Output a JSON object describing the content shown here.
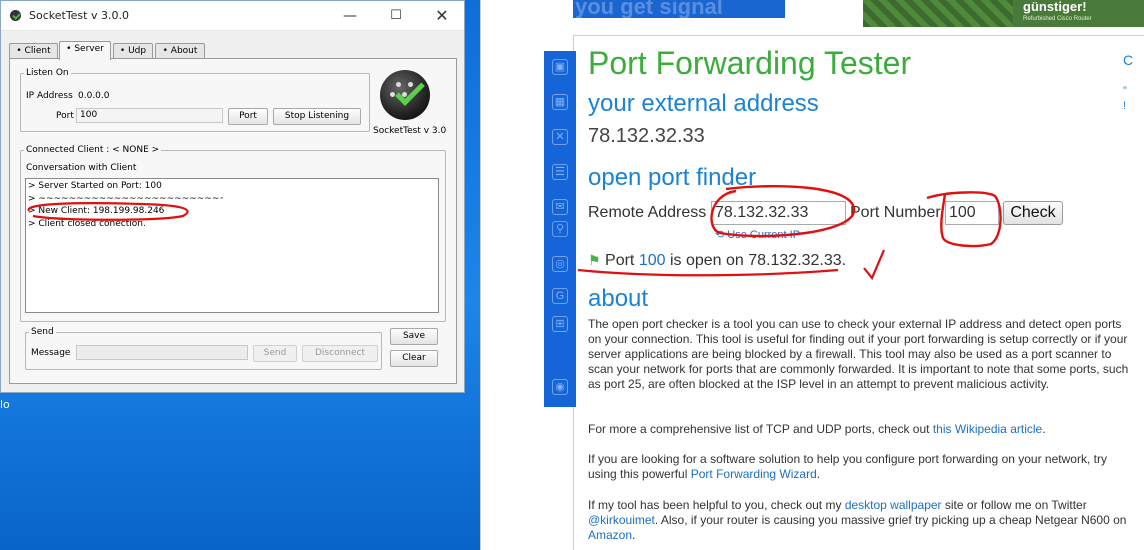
{
  "socketTest": {
    "title": "SocketTest v 3.0.0",
    "window_buttons": {
      "minimize": "—",
      "maximize": "☐",
      "close": "✕"
    },
    "tabs": [
      {
        "label": "Client"
      },
      {
        "label": "Server",
        "active": true
      },
      {
        "label": "Udp"
      },
      {
        "label": "About"
      }
    ],
    "listen": {
      "legend": "Listen On",
      "ip_label": "IP Address",
      "ip_value": "0.0.0.0",
      "port_label": "Port",
      "port_value": "100",
      "port_button": "Port",
      "stop_button": "Stop Listening"
    },
    "logo_caption": "SocketTest v 3.0",
    "connected": {
      "legend": "Connected Client : < NONE >",
      "conversation_label": "Conversation with Client",
      "log": [
        "> Server Started on Port: 100",
        "> ~~~~~~~~~~~~~~~~~~~~~~~~~~~~~~~~~",
        "> New Client: 198.199.98.246",
        "> Client closed conection."
      ]
    },
    "send": {
      "legend": "Send",
      "message_label": "Message",
      "message_value": "",
      "send_button": "Send",
      "disconnect_button": "Disconnect",
      "save_button": "Save",
      "clear_button": "Clear"
    }
  },
  "desktop_stub": "lo",
  "website": {
    "brand_fragment": "you get signal",
    "ad": {
      "headline": "günstiger!",
      "sub": "Refurbished Cisco Router"
    },
    "title": "Port Forwarding Tester",
    "external_heading": "your external address",
    "external_ip": "78.132.32.33",
    "finder_heading": "open port finder",
    "remote_label": "Remote Address",
    "remote_value": "78.132.32.33",
    "port_label": "Port Number",
    "port_value": "100",
    "check_button": "Check",
    "use_current": "Use Current IP",
    "result": {
      "prefix": "Port ",
      "port": "100",
      "middle": " is open on ",
      "ip": "78.132.32.33",
      "suffix": "."
    },
    "about_heading": "about",
    "about_p1": "The open port checker is a tool you can use to check your external IP address and detect open ports on your connection. This tool is useful for finding out if your port forwarding is setup correctly or if your server applications are being blocked by a firewall. This tool may also be used as a port scanner to scan your network for ports that are commonly forwarded. It is important to note that some ports, such as port 25, are often blocked at the ISP level in an attempt to prevent malicious activity.",
    "about_p2": {
      "text": "For more a comprehensive list of TCP and UDP ports, check out ",
      "link": "this Wikipedia article",
      "end": "."
    },
    "about_p3": {
      "text": "If you are looking for a software solution to help you configure port forwarding on your network, try using this powerful ",
      "link": "Port Forwarding Wizard",
      "end": "."
    },
    "about_p4": {
      "t1": "If my tool has been helpful to you, check out my ",
      "l1": "desktop wallpaper",
      "t2": " site or follow me on Twitter ",
      "l2": "@kirkouimet",
      "t3": ". Also, if your router is causing you massive grief try picking up a cheap Netgear N600 on ",
      "l3": "Amazon",
      "t4": "."
    },
    "sidebar_icons": [
      "lock-icon",
      "grid-icon",
      "x-icon",
      "server-icon",
      "mail-icon",
      "tool-icon",
      "target-icon",
      "google-icon",
      "windows-icon",
      "globe-icon"
    ],
    "right_strip": [
      "C",
      "\"",
      "!",
      "",
      ""
    ]
  },
  "colors": {
    "desktop": "#0b6fd6",
    "title_green": "#3cac3c",
    "heading_blue": "#1b83d6",
    "annotation_red": "#e01010"
  }
}
